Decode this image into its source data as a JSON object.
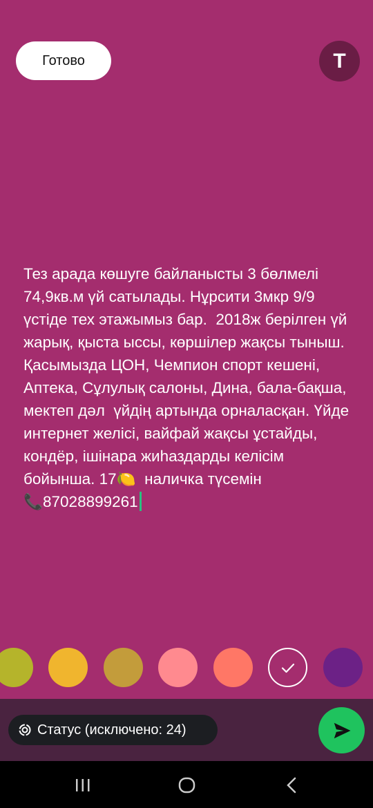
{
  "header": {
    "done_label": "Готово",
    "font_button_label": "T"
  },
  "editor": {
    "text": "Тез арада көшуге байланысты 3 бөлмелі 74,9кв.м үй сатылады. Нұрсити 3мкр 9/9 үстіде тех этажымыз бар.  2018ж берілген үй  жарық, қыста ыссы, көршілер жақсы тыныш. Қасымызда ЦОН, Чемпион спорт кешені, Аптека, Сұлулық салоны, Дина, бала-бақша, мектеп дәл  үйдің артында орналасқан. Үйде интернет желісі, вайфай жақсы ұстайды, кондёр, ішінара жиһаздарды келісім бойынша. 17🍋  наличка түсемін\n📞87028899261"
  },
  "palette": {
    "colors": [
      "#b5b42b",
      "#f0b52e",
      "#c39c3b",
      "#ff8a8f",
      "#ff7766",
      "#a42d6e",
      "#6c2186"
    ],
    "selected_index": 5
  },
  "bottom": {
    "status_chip_label": "Статус (исключено: 24)"
  },
  "icons": {
    "chip": "status-ring-icon",
    "send": "send-arrow-icon",
    "selected": "checkmark-icon",
    "nav_recent": "recent-apps-icon",
    "nav_home": "home-icon",
    "nav_back": "back-icon"
  }
}
